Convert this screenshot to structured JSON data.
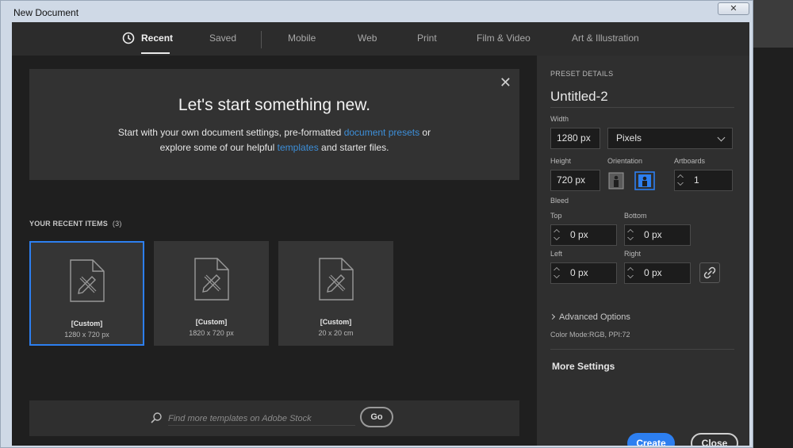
{
  "window": {
    "title": "New Document",
    "close_label": "✕"
  },
  "tabs": [
    {
      "label": "Recent",
      "active": true
    },
    {
      "label": "Saved"
    },
    {
      "label": "Mobile"
    },
    {
      "label": "Web"
    },
    {
      "label": "Print"
    },
    {
      "label": "Film & Video"
    },
    {
      "label": "Art & Illustration"
    }
  ],
  "hero": {
    "title": "Let's start something new.",
    "line1_pre": "Start with your own document settings, pre-formatted ",
    "line1_link": "document presets",
    "line1_post": " or",
    "line2_pre": "explore some of our helpful ",
    "line2_link": "templates",
    "line2_post": " and starter files.",
    "close_glyph": "✕"
  },
  "recent": {
    "label": "YOUR RECENT ITEMS",
    "count": "(3)",
    "items": [
      {
        "title": "[Custom]",
        "size": "1280 x 720 px"
      },
      {
        "title": "[Custom]",
        "size": "1820 x 720 px"
      },
      {
        "title": "[Custom]",
        "size": "20 x 20 cm"
      }
    ]
  },
  "search": {
    "placeholder": "Find more templates on Adobe Stock",
    "go_label": "Go"
  },
  "preset": {
    "heading": "PRESET DETAILS",
    "doc_name": "Untitled-2",
    "width_label": "Width",
    "width_value": "1280 px",
    "units": "Pixels",
    "height_label": "Height",
    "height_value": "720 px",
    "orientation_label": "Orientation",
    "artboards_label": "Artboards",
    "artboards_value": "1",
    "bleed_label": "Bleed",
    "top_label": "Top",
    "top_value": "0 px",
    "bottom_label": "Bottom",
    "bottom_value": "0 px",
    "left_label": "Left",
    "left_value": "0 px",
    "right_label": "Right",
    "right_value": "0 px",
    "advanced_label": "Advanced Options",
    "color_mode": "Color Mode:RGB, PPI:72",
    "more_settings": "More Settings",
    "create_label": "Create",
    "close_label": "Close"
  },
  "colors": {
    "accent": "#2d7ff0",
    "link": "#3d8fd9"
  }
}
